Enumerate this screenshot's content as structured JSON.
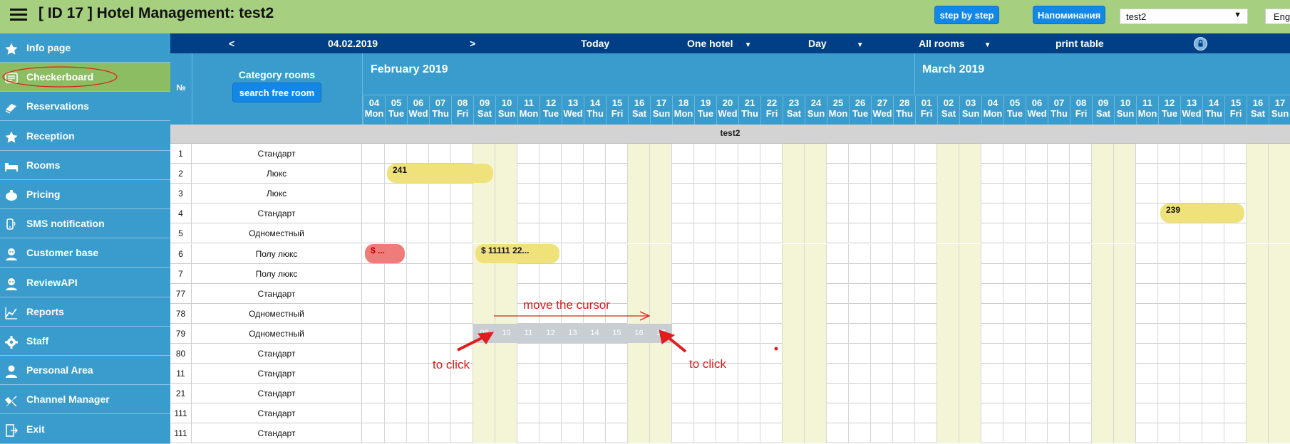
{
  "app": {
    "title": "[ ID 17 ] Hotel Management: test2"
  },
  "toolbar": {
    "step_by_step": "step by step",
    "reminders": "Напоминания",
    "hotel_select": "test2",
    "language": "Eng"
  },
  "sidebar": {
    "items": [
      {
        "label": "Info page",
        "icon": "star-icon"
      },
      {
        "label": "Checkerboard",
        "icon": "checkerboard-icon",
        "active": true
      },
      {
        "label": "Reservations",
        "icon": "eraser-icon"
      },
      {
        "label": "Reception",
        "icon": "star-icon"
      },
      {
        "label": "Rooms",
        "icon": "bed-icon"
      },
      {
        "label": "Pricing",
        "icon": "piggy-bank-icon"
      },
      {
        "label": "SMS notification",
        "icon": "phone-icon"
      },
      {
        "label": "Customer base",
        "icon": "user-icon"
      },
      {
        "label": "ReviewAPI",
        "icon": "user-icon"
      },
      {
        "label": "Reports",
        "icon": "chart-line-icon"
      },
      {
        "label": "Staff",
        "icon": "gear-icon"
      },
      {
        "label": "Personal Area",
        "icon": "person-icon"
      },
      {
        "label": "Channel Manager",
        "icon": "satellite-icon"
      },
      {
        "label": "Exit",
        "icon": "exit-icon"
      }
    ]
  },
  "navbar": {
    "prev": "<",
    "date": "04.02.2019",
    "next": ">",
    "today": "Today",
    "hotel_mode": "One hotel",
    "period": "Day",
    "rooms_filter": "All rooms",
    "print": "print table"
  },
  "header": {
    "number_col": "№",
    "category_col": "Category rooms",
    "search_button": "search free room",
    "months": [
      "February 2019",
      "March 2019"
    ],
    "days": [
      {
        "d": "04",
        "w": "Mon"
      },
      {
        "d": "05",
        "w": "Tue"
      },
      {
        "d": "06",
        "w": "Wed"
      },
      {
        "d": "07",
        "w": "Thu"
      },
      {
        "d": "08",
        "w": "Fri"
      },
      {
        "d": "09",
        "w": "Sat"
      },
      {
        "d": "10",
        "w": "Sun"
      },
      {
        "d": "11",
        "w": "Mon"
      },
      {
        "d": "12",
        "w": "Tue"
      },
      {
        "d": "13",
        "w": "Wed"
      },
      {
        "d": "14",
        "w": "Thu"
      },
      {
        "d": "15",
        "w": "Fri"
      },
      {
        "d": "16",
        "w": "Sat"
      },
      {
        "d": "17",
        "w": "Sun"
      },
      {
        "d": "18",
        "w": "Mon"
      },
      {
        "d": "19",
        "w": "Tue"
      },
      {
        "d": "20",
        "w": "Wed"
      },
      {
        "d": "21",
        "w": "Thu"
      },
      {
        "d": "22",
        "w": "Fri"
      },
      {
        "d": "23",
        "w": "Sat"
      },
      {
        "d": "24",
        "w": "Sun"
      },
      {
        "d": "25",
        "w": "Mon"
      },
      {
        "d": "26",
        "w": "Tue"
      },
      {
        "d": "27",
        "w": "Wed"
      },
      {
        "d": "28",
        "w": "Thu"
      },
      {
        "d": "01",
        "w": "Fri"
      },
      {
        "d": "02",
        "w": "Sat"
      },
      {
        "d": "03",
        "w": "Sun"
      },
      {
        "d": "04",
        "w": "Mon"
      },
      {
        "d": "05",
        "w": "Tue"
      },
      {
        "d": "06",
        "w": "Wed"
      },
      {
        "d": "07",
        "w": "Thu"
      },
      {
        "d": "08",
        "w": "Fri"
      },
      {
        "d": "09",
        "w": "Sat"
      },
      {
        "d": "10",
        "w": "Sun"
      },
      {
        "d": "11",
        "w": "Mon"
      },
      {
        "d": "12",
        "w": "Tue"
      },
      {
        "d": "13",
        "w": "Wed"
      },
      {
        "d": "14",
        "w": "Thu"
      },
      {
        "d": "15",
        "w": "Fri"
      },
      {
        "d": "16",
        "w": "Sat"
      },
      {
        "d": "17",
        "w": "Sun"
      }
    ]
  },
  "group_label": "test2",
  "rooms": [
    {
      "n": "1",
      "cat": "Стандарт"
    },
    {
      "n": "2",
      "cat": "Люкс"
    },
    {
      "n": "3",
      "cat": "Люкс"
    },
    {
      "n": "4",
      "cat": "Стандарт"
    },
    {
      "n": "5",
      "cat": "Одноместный"
    },
    {
      "n": "6",
      "cat": "Полу люкс"
    },
    {
      "n": "7",
      "cat": "Полу люкс"
    },
    {
      "n": "77",
      "cat": "Стандарт"
    },
    {
      "n": "78",
      "cat": "Одноместный"
    },
    {
      "n": "79",
      "cat": "Одноместный"
    },
    {
      "n": "80",
      "cat": "Стандарт"
    },
    {
      "n": "11",
      "cat": "Стандарт"
    },
    {
      "n": "21",
      "cat": "Стандарт"
    },
    {
      "n": "111",
      "cat": "Стандарт"
    },
    {
      "n": "111",
      "cat": "Стандарт"
    }
  ],
  "bookings": [
    {
      "row": 1,
      "start": 1,
      "end": 5,
      "label": "241",
      "color": "#efe27a"
    },
    {
      "row": 3,
      "start": 36,
      "end": 39,
      "label": "239",
      "color": "#efe27a"
    },
    {
      "row": 5,
      "start": 0,
      "end": 1,
      "label": "$ ...",
      "color": "#f07b7b"
    },
    {
      "row": 5,
      "start": 5,
      "end": 8,
      "label": "$ 11111 22...",
      "color": "#efe27a"
    }
  ],
  "selection": {
    "row": 9,
    "days": [
      "09",
      "10",
      "11",
      "12",
      "13",
      "14",
      "15",
      "16",
      "17"
    ]
  },
  "annotations": {
    "move": "move the cursor",
    "click_left": "to click",
    "click_right": "to click"
  },
  "colors": {
    "topbar": "#a6cf7f",
    "sidebar": "#3a9ccc",
    "navbar": "#003f85",
    "active_item": "#8cbd62",
    "button": "#1387e7",
    "weekend": "#f4f4d7",
    "annotation": "#e21c1c"
  }
}
